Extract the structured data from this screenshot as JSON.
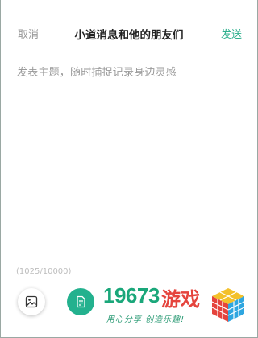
{
  "header": {
    "cancel_label": "取消",
    "title": "小道消息和他的朋友们",
    "send_label": "发送"
  },
  "editor": {
    "placeholder": "发表主题，随时捕捉记录身边灵感",
    "char_count": "(1025/10000)"
  },
  "toolbar": {
    "image_icon": "image-icon",
    "document_icon": "document-icon"
  },
  "watermark": {
    "number": "19673",
    "brand": "游戏",
    "slogan": "用心分享 创造乐趣!"
  },
  "colors": {
    "accent": "#2fb08e",
    "doc_button": "#23b18e",
    "muted_text": "#9a9a9a"
  }
}
